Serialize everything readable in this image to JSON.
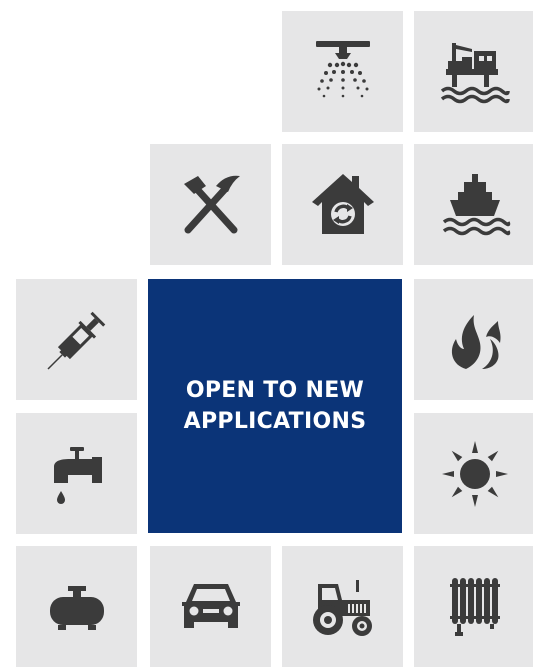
{
  "center_tile": {
    "text_line1": "OPEN TO NEW",
    "text_line2": "APPLICATIONS",
    "background": "#0b3478"
  },
  "tile_background": "#e6e6e7",
  "icon_color": "#3b3b3b",
  "icons": [
    "sprinkler-icon",
    "offshore-platform-icon",
    "mining-icon",
    "home-recycle-icon",
    "ship-icon",
    "syringe-icon",
    "flame-icon",
    "faucet-icon",
    "sun-icon",
    "tank-icon",
    "car-icon",
    "tractor-icon",
    "radiator-icon"
  ]
}
